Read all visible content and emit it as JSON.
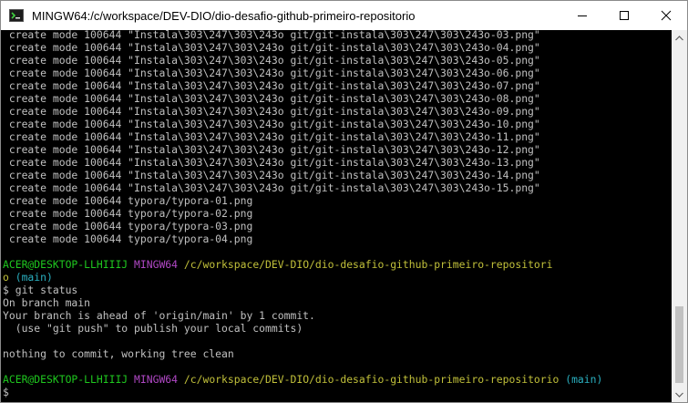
{
  "window": {
    "title": "MINGW64:/c/workspace/DEV-DIO/dio-desafio-github-primeiro-repositorio"
  },
  "terminal": {
    "create_lines": [
      " create mode 100644 \"Instala\\303\\247\\303\\243o git/git-instala\\303\\247\\303\\243o-03.png\"",
      " create mode 100644 \"Instala\\303\\247\\303\\243o git/git-instala\\303\\247\\303\\243o-04.png\"",
      " create mode 100644 \"Instala\\303\\247\\303\\243o git/git-instala\\303\\247\\303\\243o-05.png\"",
      " create mode 100644 \"Instala\\303\\247\\303\\243o git/git-instala\\303\\247\\303\\243o-06.png\"",
      " create mode 100644 \"Instala\\303\\247\\303\\243o git/git-instala\\303\\247\\303\\243o-07.png\"",
      " create mode 100644 \"Instala\\303\\247\\303\\243o git/git-instala\\303\\247\\303\\243o-08.png\"",
      " create mode 100644 \"Instala\\303\\247\\303\\243o git/git-instala\\303\\247\\303\\243o-09.png\"",
      " create mode 100644 \"Instala\\303\\247\\303\\243o git/git-instala\\303\\247\\303\\243o-10.png\"",
      " create mode 100644 \"Instala\\303\\247\\303\\243o git/git-instala\\303\\247\\303\\243o-11.png\"",
      " create mode 100644 \"Instala\\303\\247\\303\\243o git/git-instala\\303\\247\\303\\243o-12.png\"",
      " create mode 100644 \"Instala\\303\\247\\303\\243o git/git-instala\\303\\247\\303\\243o-13.png\"",
      " create mode 100644 \"Instala\\303\\247\\303\\243o git/git-instala\\303\\247\\303\\243o-14.png\"",
      " create mode 100644 \"Instala\\303\\247\\303\\243o git/git-instala\\303\\247\\303\\243o-15.png\"",
      " create mode 100644 typora/typora-01.png",
      " create mode 100644 typora/typora-02.png",
      " create mode 100644 typora/typora-03.png",
      " create mode 100644 typora/typora-04.png"
    ],
    "prompt1": {
      "user": "ACER@DESKTOP-LLHIIIJ",
      "shell": "MINGW64",
      "path_line1": "/c/workspace/DEV-DIO/dio-desafio-github-primeiro-repositori",
      "path_line2": "o",
      "branch": "(main)"
    },
    "command": "$ git status",
    "status_lines": [
      "On branch main",
      "Your branch is ahead of 'origin/main' by 1 commit.",
      "  (use \"git push\" to publish your local commits)",
      "",
      "nothing to commit, working tree clean"
    ],
    "prompt2": {
      "user": "ACER@DESKTOP-LLHIIIJ",
      "shell": "MINGW64",
      "path": "/c/workspace/DEV-DIO/dio-desafio-github-primeiro-repositorio",
      "branch": "(main)"
    },
    "cursor_prompt": "$"
  },
  "colors": {
    "user": "#1fc81f",
    "shell": "#b148c6",
    "path": "#c1c03a",
    "branch": "#2ab0c0",
    "text": "#c0c0c0",
    "background": "#000000"
  },
  "icons": {
    "app": "mingw-icon",
    "minimize": "minimize-icon",
    "maximize": "maximize-icon",
    "close": "close-icon",
    "scroll_up": "scroll-up-arrow-icon",
    "scroll_down": "scroll-down-arrow-icon"
  }
}
